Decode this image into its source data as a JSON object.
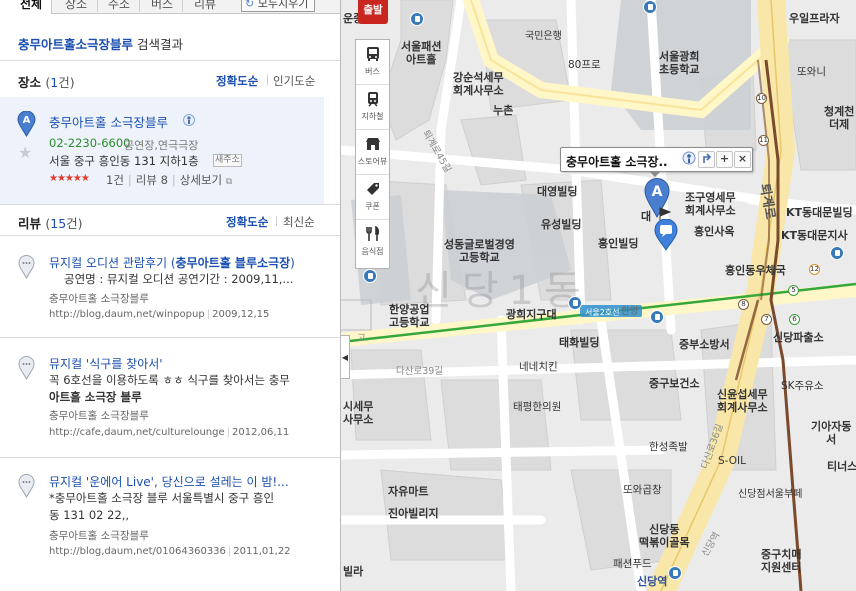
{
  "tabs": [
    "전체",
    "장소",
    "주소",
    "버스",
    "리뷰"
  ],
  "reset_label": "모두지우기",
  "search": {
    "query": "충무아트홀소극장블루",
    "suffix": "검색결과"
  },
  "places_section": {
    "title": "장소",
    "count_open": "(",
    "count": "1",
    "count_close": "건)",
    "sort_accuracy": "정확도순",
    "sort_popular": "인기도순"
  },
  "place": {
    "marker": "A",
    "name": "충무아트홀 소극장블루",
    "phone": "02-2230-6600",
    "category": "공연장,연극극장",
    "address": "서울 중구 흥인동 131 지하1층",
    "new_address_badge": "새주소",
    "rating": 4.5,
    "stars": "★★★★★",
    "count": "1건",
    "reviews": "리뷰 8",
    "detail": "상세보기"
  },
  "reviews_section": {
    "title": "리뷰",
    "count_open": "(",
    "count": "15",
    "count_close": "건)",
    "sort_accuracy": "정확도순",
    "sort_latest": "최신순"
  },
  "reviews": [
    {
      "title_prefix": "뮤지컬 오디션 관람후기 (",
      "title_bold": "충무아트홀 블루소극장",
      "title_suffix": ")",
      "line2": "공연명 : 뮤지컬 오디션 공연기간 : 2009,11,...",
      "line3": "",
      "source": "충무아트홀 소극장블루",
      "url": "http://blog,daum,net/winpopup",
      "date": "2009,12,15"
    },
    {
      "title_prefix": "뮤지컬 '식구를 찾아서'",
      "title_bold": "",
      "title_suffix": "",
      "line2": "꼭 6호선을 이용하도록 ㅎㅎ 식구를 찾아서는 충무",
      "line3": "아트홀 소극장 블루",
      "source": "충무아트홀 소극장블루",
      "url": "http://cafe,daum,net/culturelounge",
      "date": "2012,06,11"
    },
    {
      "title_prefix": "뮤지컬 '운에어 Live', 당신으로 설레는 이 밤!...",
      "title_bold": "",
      "title_suffix": "",
      "line2": "*충무아트홀 소극장 블루 서울특별시 중구 흥인",
      "line3": "동 131 02 22,,",
      "source": "충무아트홀 소극장블루",
      "url": "http://blog,daum,net/01064360336",
      "date": "2011,01,22"
    }
  ],
  "map": {
    "toolbox": {
      "badge": "출발",
      "tools": [
        "버스",
        "지하철",
        "스토어뷰",
        "쿠폰",
        "음식점"
      ]
    },
    "popup": {
      "title": "충무아트홀 소극장..",
      "btn_plus": "+",
      "btn_close": "×"
    },
    "district": "신당1동",
    "route_label": "서울2호선",
    "road_labels": {
      "dasan": "다산로39길",
      "gil45": "퇴계로45길",
      "toegye": "퇴계로",
      "sindang": "신당역",
      "hanyang": "한양",
      "danggil": "다산로36길"
    },
    "markers": {
      "a": "A"
    },
    "metro_numbers": [
      "10",
      "11",
      "8",
      "7",
      "6",
      "5",
      "12"
    ],
    "labels": {
      "seoulfashion": "서울패션\n아트홀",
      "gukmin": "국민은행",
      "80": "80프로",
      "seoulgwanghui": "서울광희\n초등학교",
      "gangsun": "강순석세무\n회계사무소",
      "nuchon": "누촌",
      "daeyoung": "대영빌딩",
      "yuseong": "유성빌딩",
      "heungin": "흥인빌딩",
      "seongdong": "성동글로벌경영\n고등학교",
      "jowon": "조구영세무\n회계사무소",
      "heunginsaok": "흥인사옥",
      "kt1": "KT동대문빌딩",
      "kt2": "KT동대문지사",
      "post": "흥인동우체국",
      "sindangpa": "신당파출소",
      "gwanghui": "광희지구대",
      "taehwa": "태화빌딩",
      "hanyanggong": "한양공업\n고등학교",
      "nene": "네네치킨",
      "taepyeong": "태평한의원",
      "jungbu": "중부소방서",
      "jungguhealth": "중구보건소",
      "sinyun": "신윤섭세무\n회계사무소",
      "sk": "SK주유소",
      "hanseong": "한성족발",
      "soil": "S-OIL",
      "ttoa": "또와곱창",
      "sindangjeom": "신당점서울부페",
      "yuyu": "자유마트",
      "jinavil": "진아빌리지",
      "sindangdong": "신당동\n떡볶이골목",
      "paesyeon": "패션푸드",
      "sindangyeok": "신당역",
      "jungguchimae": "중구치매\n지원센터",
      "ujeong": "우일프라자",
      "ttowangi": "또와니",
      "cheonggye": "청계천\n더제",
      "giasa": "기아자동\n서",
      "tiner": "티너스",
      "sisemu": "시세무\n사무소",
      "villa": "빌라",
      "mun": "운종",
      "daei": "대",
      "gogong": "고"
    }
  }
}
